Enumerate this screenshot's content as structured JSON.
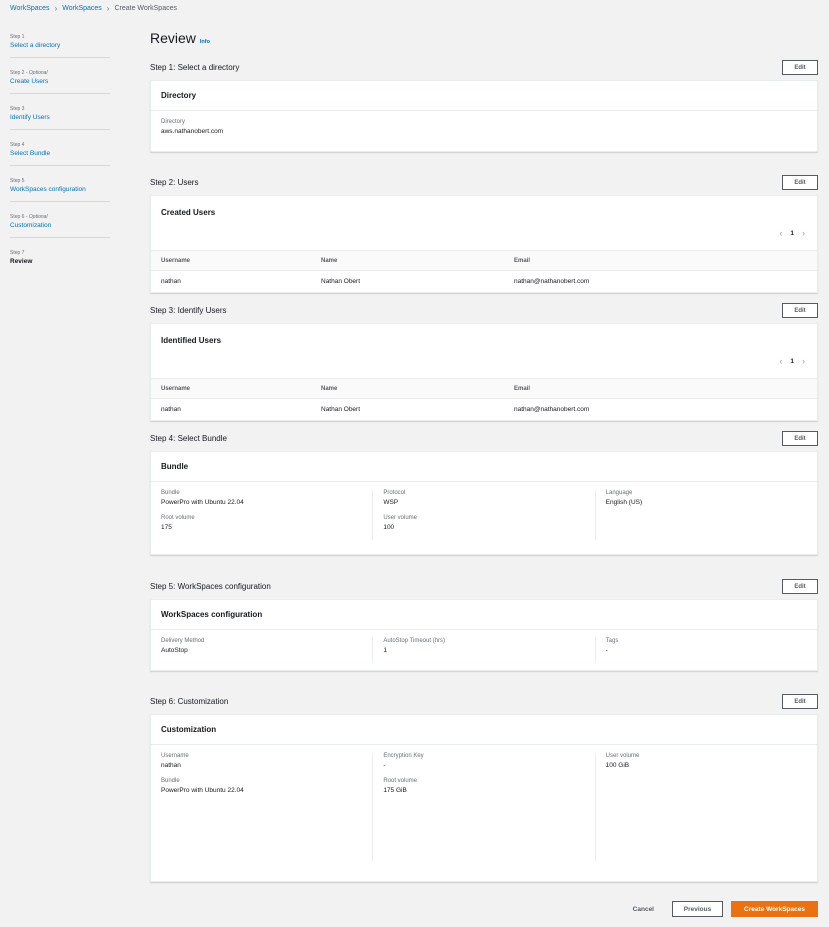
{
  "breadcrumb": {
    "items": [
      "WorkSpaces",
      "WorkSpaces"
    ],
    "current": "Create WorkSpaces"
  },
  "nav": [
    {
      "num": "Step 1",
      "optional": "",
      "label": "Select a directory"
    },
    {
      "num": "Step 2",
      "optional": "Optional",
      "label": "Create Users"
    },
    {
      "num": "Step 3",
      "optional": "",
      "label": "Identify Users"
    },
    {
      "num": "Step 4",
      "optional": "",
      "label": "Select Bundle"
    },
    {
      "num": "Step 5",
      "optional": "",
      "label": "WorkSpaces configuration"
    },
    {
      "num": "Step 6",
      "optional": "Optional",
      "label": "Customization"
    },
    {
      "num": "Step 7",
      "optional": "",
      "label": "Review"
    }
  ],
  "page": {
    "title": "Review",
    "info": "Info",
    "edit_label": "Edit"
  },
  "step1": {
    "title": "Step 1: Select a directory",
    "card_title": "Directory",
    "fields": [
      {
        "label": "Directory",
        "value": "aws.nathanobert.com"
      }
    ]
  },
  "step2": {
    "title": "Step 2: Users",
    "card_title": "Created Users",
    "page": "1",
    "columns": [
      "Username",
      "Name",
      "Email"
    ],
    "rows": [
      [
        "nathan",
        "Nathan Obert",
        "nathan@nathanobert.com"
      ]
    ]
  },
  "step3": {
    "title": "Step 3: Identify Users",
    "card_title": "Identified Users",
    "page": "1",
    "columns": [
      "Username",
      "Name",
      "Email"
    ],
    "rows": [
      [
        "nathan",
        "Nathan Obert",
        "nathan@nathanobert.com"
      ]
    ]
  },
  "step4": {
    "title": "Step 4: Select Bundle",
    "card_title": "Bundle",
    "cols": [
      [
        {
          "label": "Bundle",
          "value": "PowerPro with Ubuntu 22.04"
        },
        {
          "label": "Root volume",
          "value": "175"
        }
      ],
      [
        {
          "label": "Protocol",
          "value": "WSP"
        },
        {
          "label": "User volume",
          "value": "100"
        }
      ],
      [
        {
          "label": "Language",
          "value": "English (US)"
        }
      ]
    ]
  },
  "step5": {
    "title": "Step 5: WorkSpaces configuration",
    "card_title": "WorkSpaces configuration",
    "cols": [
      [
        {
          "label": "Delivery Method",
          "value": "AutoStop"
        }
      ],
      [
        {
          "label": "AutoStop Timeout (hrs)",
          "value": "1"
        }
      ],
      [
        {
          "label": "Tags",
          "value": "-"
        }
      ]
    ]
  },
  "step6": {
    "title": "Step 6: Customization",
    "card_title": "Customization",
    "cols": [
      [
        {
          "label": "Username",
          "value": "nathan"
        },
        {
          "label": "Bundle",
          "value": "PowerPro with Ubuntu 22.04"
        }
      ],
      [
        {
          "label": "Encryption Key",
          "value": "-"
        },
        {
          "label": "Root volume",
          "value": "175 GiB"
        }
      ],
      [
        {
          "label": "User volume",
          "value": "100 GiB"
        }
      ]
    ]
  },
  "footer": {
    "cancel": "Cancel",
    "previous": "Previous",
    "create": "Create WorkSpaces"
  }
}
